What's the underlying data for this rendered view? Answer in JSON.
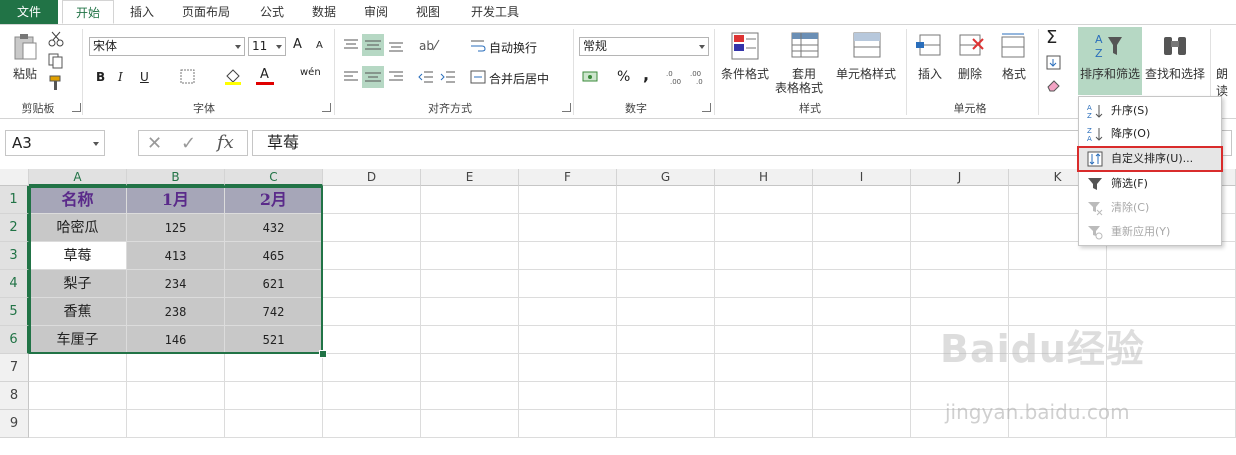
{
  "tabs": [
    "文件",
    "开始",
    "插入",
    "页面布局",
    "公式",
    "数据",
    "审阅",
    "视图",
    "开发工具"
  ],
  "active_tab": "开始",
  "clipboard": {
    "paste": "粘贴",
    "group": "剪贴板"
  },
  "font": {
    "name": "宋体",
    "size": "11",
    "group": "字体",
    "bold": "B",
    "italic": "I",
    "underline": "U",
    "grow": "A",
    "shrink": "A",
    "color_a": "A",
    "wen": "wén"
  },
  "alignment": {
    "wrap": "自动换行",
    "merge": "合并后居中",
    "group": "对齐方式"
  },
  "number": {
    "format": "常规",
    "percent": "%",
    "comma": ",",
    "group": "数字"
  },
  "styles": {
    "conditional": "条件格式",
    "table_line1": "套用",
    "table_line2": "表格格式",
    "cell": "单元格样式",
    "group": "样式"
  },
  "cells": {
    "insert": "插入",
    "delete": "删除",
    "format": "格式",
    "group": "单元格"
  },
  "editing": {
    "sort_filter": "排序和筛选",
    "find_select": "查找和选择",
    "read": "朗读"
  },
  "name_box": "A3",
  "formula": "草莓",
  "fx": "fx",
  "columns": [
    "A",
    "B",
    "C",
    "D",
    "E",
    "F",
    "G",
    "H",
    "I",
    "J",
    "K"
  ],
  "rows": [
    "1",
    "2",
    "3",
    "4",
    "5",
    "6",
    "7",
    "8",
    "9"
  ],
  "table": {
    "header": [
      "名称",
      "1月",
      "2月"
    ],
    "rows": [
      [
        "哈密瓜",
        "125",
        "432"
      ],
      [
        "草莓",
        "413",
        "465"
      ],
      [
        "梨子",
        "234",
        "621"
      ],
      [
        "香蕉",
        "238",
        "742"
      ],
      [
        "车厘子",
        "146",
        "521"
      ]
    ]
  },
  "sort_menu": [
    {
      "label": "升序(S)",
      "enabled": true
    },
    {
      "label": "降序(O)",
      "enabled": true
    },
    {
      "label": "自定义排序(U)...",
      "enabled": true
    },
    {
      "label": "筛选(F)",
      "enabled": true
    },
    {
      "label": "清除(C)",
      "enabled": false
    },
    {
      "label": "重新应用(Y)",
      "enabled": false
    }
  ],
  "watermark": {
    "brand": "Baidu经验",
    "url": "jingyan.baidu.com"
  },
  "colors": {
    "accent": "#217346",
    "header_fill": "#a6a6b8",
    "header_text": "#5a2a8a",
    "data_fill": "#c8c8c8",
    "highlight": "#d92c2c"
  }
}
